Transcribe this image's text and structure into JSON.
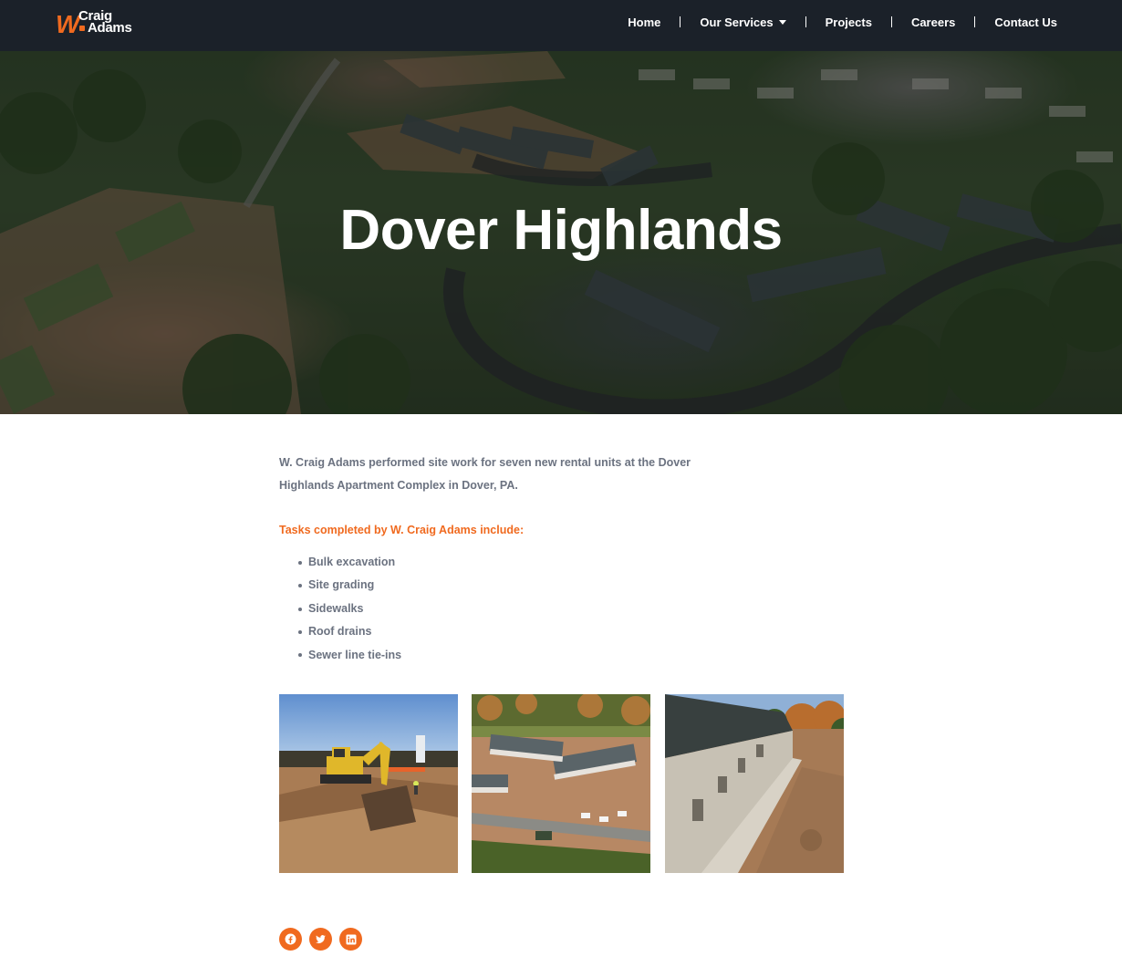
{
  "header": {
    "logo": {
      "mark": "W",
      "line1": "Craig",
      "line2": "Adams"
    },
    "nav": [
      {
        "label": "Home"
      },
      {
        "label": "Our Services",
        "has_dropdown": true
      },
      {
        "label": "Projects"
      },
      {
        "label": "Careers"
      },
      {
        "label": "Contact Us"
      }
    ]
  },
  "hero": {
    "title": "Dover Highlands"
  },
  "content": {
    "intro": "W. Craig Adams performed site work for seven new rental units at the Dover Highlands Apartment Complex in Dover, PA.",
    "tasks_heading": "Tasks completed by W. Craig Adams include:",
    "tasks": [
      "Bulk excavation",
      "Site grading",
      "Sidewalks",
      "Roof drains",
      "Sewer line tie-ins"
    ]
  },
  "gallery": [
    {
      "icon": "excavator-photo"
    },
    {
      "icon": "aerial-site-photo"
    },
    {
      "icon": "building-sidewalk-photo"
    }
  ],
  "social": [
    {
      "icon": "facebook-icon"
    },
    {
      "icon": "twitter-icon"
    },
    {
      "icon": "linkedin-icon"
    }
  ],
  "colors": {
    "accent": "#f06a1f",
    "header_bg": "#1b2129",
    "text": "#6b7280"
  }
}
